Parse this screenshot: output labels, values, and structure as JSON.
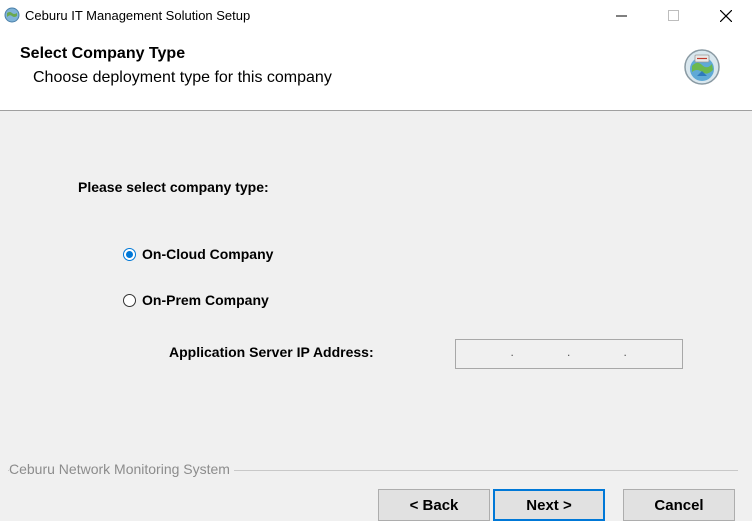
{
  "window": {
    "title": "Ceburu IT Management Solution Setup",
    "controls": {
      "minimize": "—",
      "maximize": "☐",
      "close": "✕"
    }
  },
  "header": {
    "title": "Select Company Type",
    "subtitle": "Choose deployment type for this company"
  },
  "body": {
    "prompt": "Please select company type:",
    "options": [
      {
        "label": "On-Cloud Company",
        "selected": true
      },
      {
        "label": "On-Prem Company",
        "selected": false
      }
    ],
    "ip_label": "Application Server IP Address:",
    "ip_value": ""
  },
  "footer": {
    "brand": "Ceburu Network Monitoring System",
    "back_label": "< Back",
    "next_label": "Next >",
    "cancel_label": "Cancel"
  },
  "colors": {
    "accent": "#0078d7",
    "brand_text": "#8c8c8c"
  }
}
